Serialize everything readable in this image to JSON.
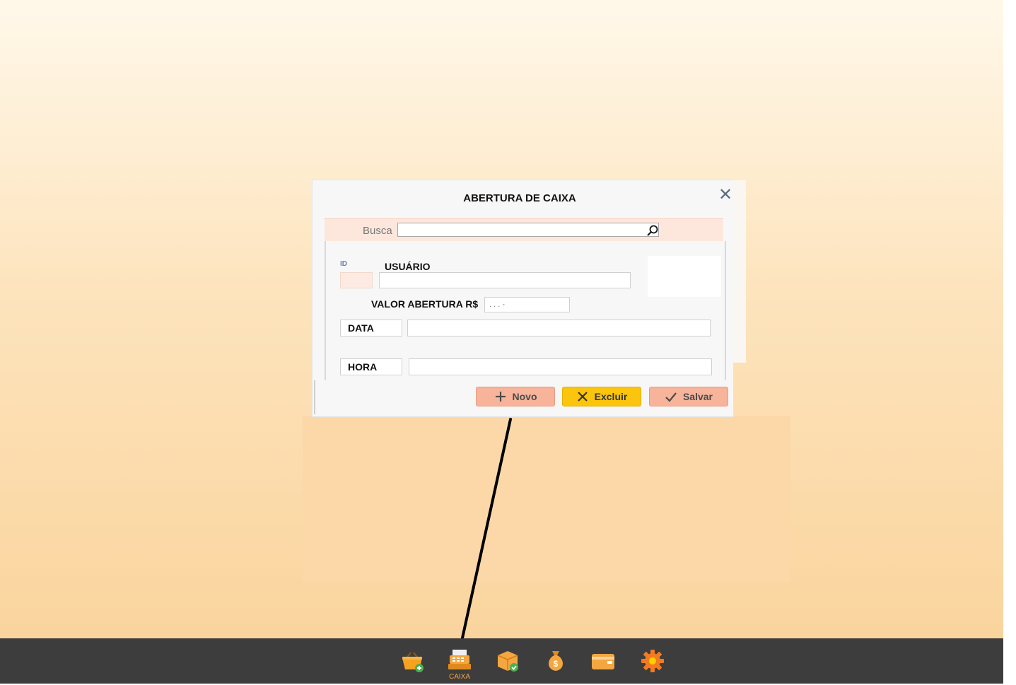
{
  "dialog": {
    "title": "ABERTURA DE CAIXA",
    "search": {
      "label": "Busca",
      "value": "",
      "placeholder": ""
    },
    "fields": {
      "id_label": "ID",
      "id_value": "",
      "usuario_label": "USUÁRIO",
      "usuario_value": "",
      "valor_label": "VALOR ABERTURA R$",
      "valor_mask": "  . . .  -",
      "data_label": "DATA",
      "data_value": "",
      "hora_label": "HORA",
      "hora_value": ""
    },
    "buttons": {
      "novo": "Novo",
      "excluir": "Excluir",
      "salvar": "Salvar"
    }
  },
  "taskbar": {
    "items": [
      {
        "icon": "basket-add-icon"
      },
      {
        "icon": "cash-register-icon",
        "caption": "CAIXA"
      },
      {
        "icon": "box-check-icon"
      },
      {
        "icon": "money-bag-icon"
      },
      {
        "icon": "wallet-icon"
      },
      {
        "icon": "gear-icon"
      }
    ]
  },
  "colors": {
    "accent_orange": "#f4a640",
    "button_salmon": "#f7b49a",
    "button_yellow": "#fcc50d",
    "taskbar": "#3d3d3d"
  }
}
